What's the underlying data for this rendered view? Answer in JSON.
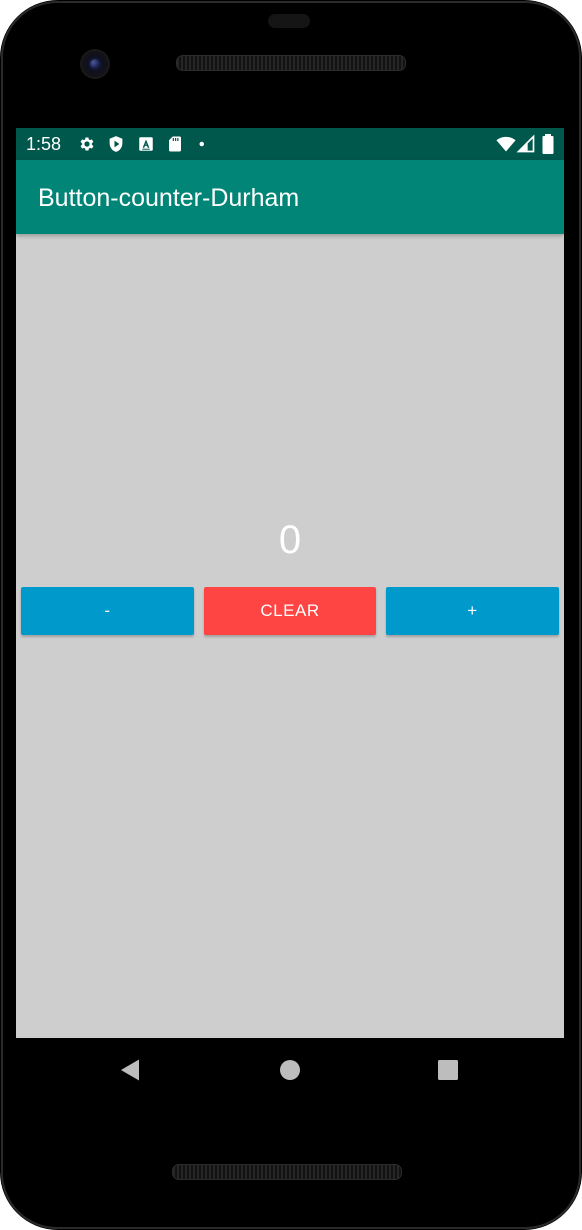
{
  "status_bar": {
    "time": "1:58",
    "icons": [
      "gear-icon",
      "play-shield-icon",
      "a-box-icon",
      "sd-card-icon",
      "dot-icon",
      "wifi-icon",
      "signal-icon",
      "battery-icon"
    ]
  },
  "app_bar": {
    "title": "Button-counter-Durham"
  },
  "main": {
    "counter_value": "0",
    "buttons": {
      "decrement_label": "-",
      "clear_label": "CLEAR",
      "increment_label": "+"
    }
  },
  "nav_bar": {
    "icons": [
      "back-icon",
      "home-icon",
      "recents-icon"
    ]
  },
  "colors": {
    "status_bar": "#00574b",
    "app_bar": "#008577",
    "screen_background": "#cecece",
    "button_blue": "#0099cc",
    "button_red": "#ff4444"
  }
}
